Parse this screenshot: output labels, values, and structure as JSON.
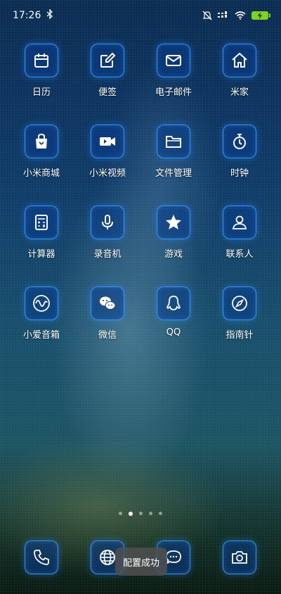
{
  "status_bar": {
    "time": "17:26",
    "icons": [
      "bluetooth-icon",
      "mute-bell-icon",
      "signal-icon",
      "wifi-icon",
      "battery-charging-icon"
    ],
    "battery_color": "#7ed321"
  },
  "apps": [
    {
      "label": "日历",
      "icon": "calendar-icon"
    },
    {
      "label": "便签",
      "icon": "notes-icon"
    },
    {
      "label": "电子邮件",
      "icon": "mail-icon"
    },
    {
      "label": "米家",
      "icon": "home-icon"
    },
    {
      "label": "小米商城",
      "icon": "shopping-bag-icon"
    },
    {
      "label": "小米视频",
      "icon": "video-icon"
    },
    {
      "label": "文件管理",
      "icon": "folder-icon"
    },
    {
      "label": "时钟",
      "icon": "stopwatch-icon"
    },
    {
      "label": "计算器",
      "icon": "calculator-icon"
    },
    {
      "label": "录音机",
      "icon": "microphone-icon"
    },
    {
      "label": "游戏",
      "icon": "star-icon"
    },
    {
      "label": "联系人",
      "icon": "contact-icon"
    },
    {
      "label": "小爱音箱",
      "icon": "wave-icon"
    },
    {
      "label": "微信",
      "icon": "wechat-icon"
    },
    {
      "label": "QQ",
      "icon": "qq-icon"
    },
    {
      "label": "指南针",
      "icon": "compass-icon"
    }
  ],
  "page_indicator": {
    "count": 5,
    "active": 1
  },
  "dock": [
    {
      "icon": "phone-icon"
    },
    {
      "icon": "browser-globe-icon"
    },
    {
      "icon": "messages-icon"
    },
    {
      "icon": "camera-icon"
    }
  ],
  "toast": {
    "text": "配置成功"
  },
  "accent_color": "#46a0ff"
}
